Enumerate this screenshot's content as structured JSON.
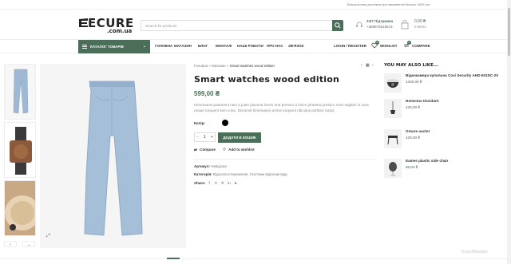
{
  "topbar": {
    "note": "Безкоштовна доставка при замовленні більше 1500 грн"
  },
  "header": {
    "logo_word": "ECURE",
    "logo_sub": ".com.ua",
    "search_placeholder": "Search for products",
    "support_title": "24/7 Підтримка",
    "support_phone": "+380675515572",
    "cart_price": "0,00 ₴",
    "cart_items": "0 items",
    "cart_count": "0"
  },
  "nav": {
    "categories_label": "КАТАЛОГ ТОВАРІВ",
    "items": [
      "ГОЛОВНА",
      "МАГАЗИН",
      "БЛОГ",
      "МОНТАЖ",
      "НАШІ РОБОТИ",
      "ПРО НАС",
      "ЗВ'ЯЗОК"
    ],
    "login_label": "LOGIN / REGISTER",
    "wishlist_label": "WISHLIST",
    "wishlist_count": "0",
    "compare_label": "COMPARE",
    "compare_count": "0"
  },
  "breadcrumb": {
    "home": "Головна",
    "sep": "»",
    "shop": "Магазин",
    "current": "Smart watches wood edition"
  },
  "product": {
    "title": "Smart watches wood edition",
    "price": "599,00 ₴",
    "description": "Himenaeos parturient nam a justo placerat lorem erat pretium a fusce pharetra pretium enim sagittis ut nunc neque torquent sem a leo. Dictumst himenaeos primis torquent ridiculus porttitor turpis.",
    "color_label": "Колір:",
    "color_value": "#000000",
    "qty_minus": "-",
    "qty_value": "1",
    "qty_plus": "+",
    "add_to_cart": "ДОДАТИ В КОШИК",
    "compare": "Compare",
    "wishlist": "Add to wishlist",
    "sku_label": "Артикул:",
    "sku_value": "Невідомо",
    "category_label": "Категорія:",
    "category_value": "Відеоспостереження, Системи відеонагляду",
    "share_label": "Share:"
  },
  "sidebar": {
    "heading": "YOU MAY ALSO LIKE...",
    "items": [
      {
        "name": "Відеокамера купольна Covi Security AHD-501DC-20",
        "price": "1330,00 ₴"
      },
      {
        "name": "Henectus tincidunt",
        "price": "429,00 ₴"
      },
      {
        "name": "Ornare auctor",
        "price": "429,00 ₴"
      },
      {
        "name": "Eames plastic side chair",
        "price": "99,00 ₴"
      }
    ]
  },
  "watermark": "ScanMalware",
  "colors": {
    "accent": "#4a6e57",
    "price": "#4a6e57"
  }
}
